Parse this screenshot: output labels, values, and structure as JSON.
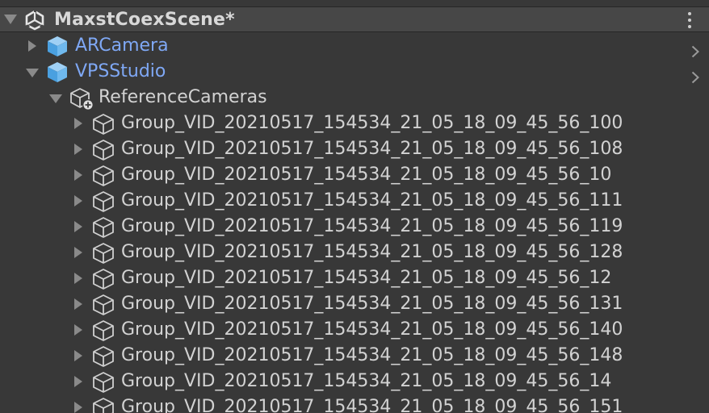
{
  "scene": {
    "name": "MaxstCoexScene*"
  },
  "prefabs": [
    {
      "label": "ARCamera",
      "expanded": false
    },
    {
      "label": "VPSStudio",
      "expanded": true
    }
  ],
  "reference_node": {
    "label": "ReferenceCameras",
    "expanded": true
  },
  "groups": [
    "Group_VID_20210517_154534_21_05_18_09_45_56_100",
    "Group_VID_20210517_154534_21_05_18_09_45_56_108",
    "Group_VID_20210517_154534_21_05_18_09_45_56_10",
    "Group_VID_20210517_154534_21_05_18_09_45_56_111",
    "Group_VID_20210517_154534_21_05_18_09_45_56_119",
    "Group_VID_20210517_154534_21_05_18_09_45_56_128",
    "Group_VID_20210517_154534_21_05_18_09_45_56_12",
    "Group_VID_20210517_154534_21_05_18_09_45_56_131",
    "Group_VID_20210517_154534_21_05_18_09_45_56_140",
    "Group_VID_20210517_154534_21_05_18_09_45_56_148",
    "Group_VID_20210517_154534_21_05_18_09_45_56_14",
    "Group_VID_20210517_154534_21_05_18_09_45_56_151"
  ],
  "colors": {
    "background": "#383838",
    "scene_header": "#474747",
    "text": "#d2d2d2",
    "prefab_text": "#7fa8f5",
    "prefab_icon": "#5aa9e6",
    "arrow": "#8a8a8a"
  }
}
